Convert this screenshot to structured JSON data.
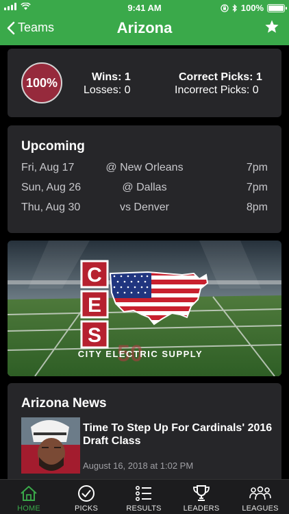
{
  "status_bar": {
    "time": "9:41 AM",
    "battery": "100%"
  },
  "nav": {
    "back_label": "Teams",
    "title": "Arizona"
  },
  "stats": {
    "percent": "100%",
    "wins": "Wins: 1",
    "losses": "Losses: 0",
    "correct": "Correct Picks: 1",
    "incorrect": "Incorrect Picks: 0"
  },
  "upcoming": {
    "title": "Upcoming",
    "games": [
      {
        "date": "Fri, Aug 17",
        "opponent": "@ New Orleans",
        "time": "7pm"
      },
      {
        "date": "Sun, Aug 26",
        "opponent": "@ Dallas",
        "time": "7pm"
      },
      {
        "date": "Thu, Aug 30",
        "opponent": "vs Denver",
        "time": "8pm"
      }
    ]
  },
  "banner": {
    "letters": [
      "C",
      "E",
      "S"
    ],
    "text": "CITY ELECTRIC SUPPLY"
  },
  "news": {
    "title": "Arizona News",
    "items": [
      {
        "headline": "Time To Step Up For Cardinals' 2016 Draft Class",
        "date": "August 16, 2018 at 1:02 PM"
      }
    ]
  },
  "tabs": [
    {
      "label": "HOME",
      "icon": "home-icon",
      "active": true
    },
    {
      "label": "PICKS",
      "icon": "checkmark-circle-icon",
      "active": false
    },
    {
      "label": "RESULTS",
      "icon": "list-icon",
      "active": false
    },
    {
      "label": "LEADERS",
      "icon": "trophy-icon",
      "active": false
    },
    {
      "label": "LEAGUES",
      "icon": "people-icon",
      "active": false
    }
  ],
  "colors": {
    "brand": "#3aa94a",
    "card": "#262629",
    "badge": "#962a3c",
    "background": "#000000"
  }
}
